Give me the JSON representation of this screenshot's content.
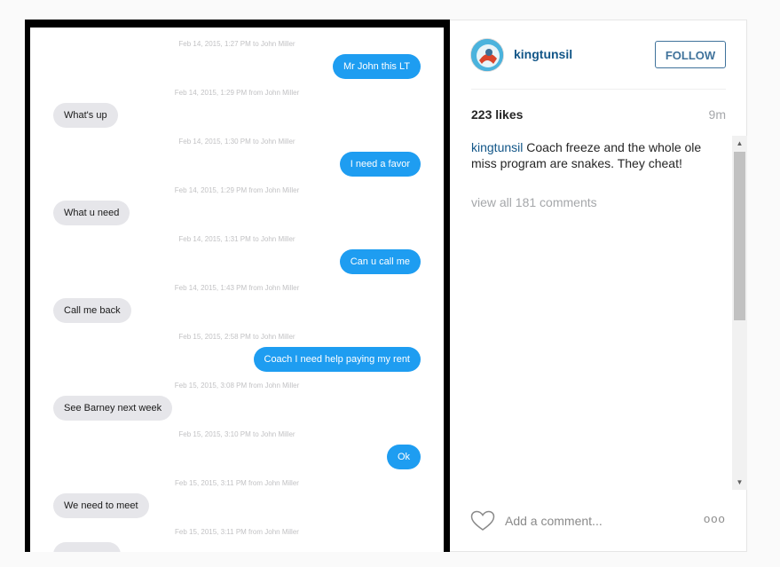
{
  "photo": {
    "messages": [
      {
        "timestamp": "Feb 14, 2015, 1:27 PM to John Miller",
        "text": "Mr John this LT",
        "direction": "out"
      },
      {
        "timestamp": "Feb 14, 2015, 1:29 PM from John Miller",
        "text": "What's up",
        "direction": "in"
      },
      {
        "timestamp": "Feb 14, 2015, 1:30 PM to John Miller",
        "text": "I need a favor",
        "direction": "out"
      },
      {
        "timestamp": "Feb 14, 2015, 1:29 PM from John Miller",
        "text": "What u need",
        "direction": "in"
      },
      {
        "timestamp": "Feb 14, 2015, 1:31 PM to John Miller",
        "text": "Can u call me",
        "direction": "out"
      },
      {
        "timestamp": "Feb 14, 2015, 1:43 PM from John Miller",
        "text": "Call me back",
        "direction": "in"
      },
      {
        "timestamp": "Feb 15, 2015, 2:58 PM to John Miller",
        "text": "Coach I need help paying my rent",
        "direction": "out"
      },
      {
        "timestamp": "Feb 15, 2015, 3:08 PM from John Miller",
        "text": "See Barney next week",
        "direction": "in"
      },
      {
        "timestamp": "Feb 15, 2015, 3:10 PM to John Miller",
        "text": "Ok",
        "direction": "out"
      },
      {
        "timestamp": "Feb 15, 2015, 3:11 PM from John Miller",
        "text": "We need to meet",
        "direction": "in"
      },
      {
        "timestamp": "Feb 15, 2015, 3:11 PM from John Miller",
        "text": "",
        "direction": "in"
      }
    ]
  },
  "post": {
    "username": "kingtunsil",
    "follow_label": "FOLLOW",
    "likes": "223 likes",
    "time_ago": "9m",
    "caption_user": "kingtunsil",
    "caption_text": "Coach freeze and the whole ole miss program are snakes. They cheat!",
    "view_all": "view all 181 comments",
    "comment_placeholder": "Add a comment...",
    "more_label": "ooo"
  },
  "scrollbar": {
    "up_arrow": "▲",
    "down_arrow": "▼"
  },
  "colors": {
    "accent": "#125688",
    "imessage_blue": "#1e9df1",
    "bubble_gray": "#e6e6ea"
  }
}
